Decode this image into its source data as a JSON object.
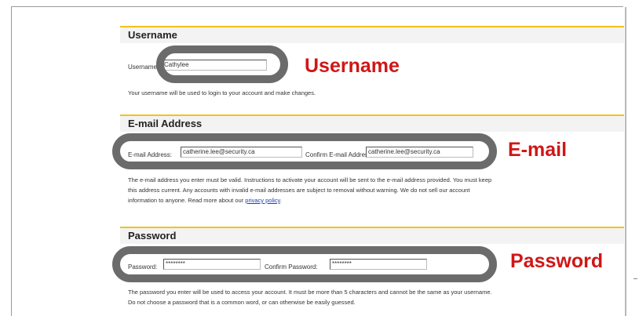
{
  "sections": {
    "username": {
      "title": "Username",
      "label": "Username:",
      "value": "Cathylee",
      "help": "Your username will be used to login to your account and make changes."
    },
    "email": {
      "title": "E-mail Address",
      "label": "E-mail Address:",
      "value": "catherine.lee@security.ca",
      "confirm_label": "Confirm E-mail Address:",
      "confirm_value": "catherine.lee@security.ca",
      "help_line1": "The e-mail address you enter must be valid. Instructions to activate your account will be sent to the e-mail address provided. You must keep",
      "help_line2": "this address current. Any accounts with invalid e-mail addresses are subject to removal without warning. We do not sell our account",
      "help_line3": "information to anyone. Read more about our",
      "privacy_link": "privacy policy",
      "help_end": "."
    },
    "password": {
      "title": "Password",
      "label": "Password:",
      "value": "********",
      "confirm_label": "Confirm Password:",
      "confirm_value": "********",
      "help_line1": "The password you enter will be used to access your account. It must be more than 5 characters and cannot be the same as your username.",
      "help_line2": "Do not choose a password that is a common word, or can otherwise be easily guessed."
    }
  },
  "callouts": {
    "username": "Username",
    "email": "E-mail",
    "password": "Password"
  },
  "colors": {
    "callout_red": "#d01616",
    "ring_gray": "#6b6b6b",
    "header_rule": "#f0c419",
    "header_bg": "#f3f3f3",
    "link_blue": "#1a3fb8"
  }
}
